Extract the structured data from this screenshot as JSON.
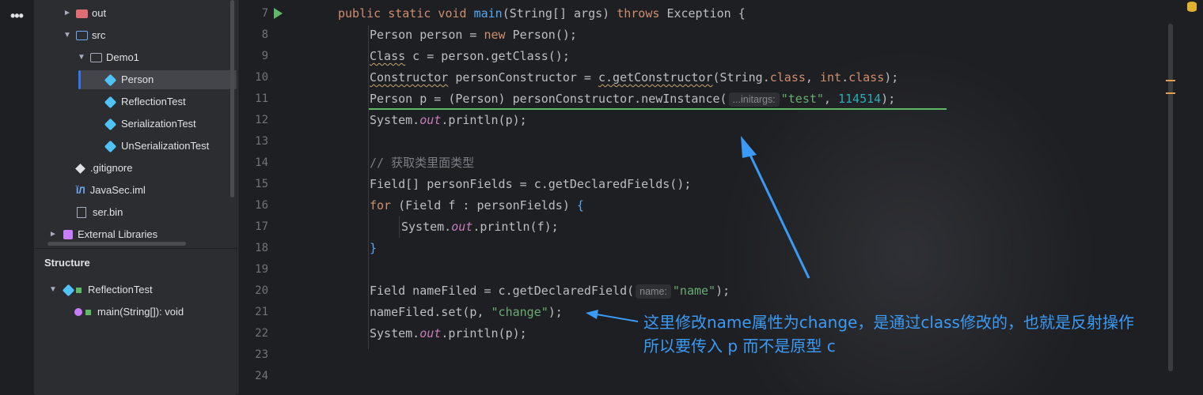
{
  "project_tree": {
    "items": [
      {
        "label": "out",
        "icon": "folder-excluded-icon"
      },
      {
        "label": "src",
        "icon": "source-folder-icon"
      },
      {
        "label": "Demo1",
        "icon": "package-icon"
      },
      {
        "label": "Person",
        "icon": "java-class-icon"
      },
      {
        "label": "ReflectionTest",
        "icon": "java-class-icon"
      },
      {
        "label": "SerializationTest",
        "icon": "java-class-icon"
      },
      {
        "label": "UnSerializationTest",
        "icon": "java-class-icon"
      },
      {
        "label": ".gitignore",
        "icon": "git-icon"
      },
      {
        "label": "JavaSec.iml",
        "icon": "iml-file-icon"
      },
      {
        "label": "ser.bin",
        "icon": "binary-file-icon"
      },
      {
        "label": "External Libraries",
        "icon": "libraries-icon"
      }
    ]
  },
  "structure": {
    "title": "Structure",
    "class_name": "ReflectionTest",
    "method": "main(String[]): void"
  },
  "editor": {
    "line_numbers": [
      "7",
      "8",
      "9",
      "10",
      "11",
      "12",
      "13",
      "14",
      "15",
      "16",
      "17",
      "18",
      "19",
      "20",
      "21",
      "22",
      "23",
      "24"
    ],
    "hints": {
      "initargs": "...initargs:",
      "name": "name:"
    },
    "strings": {
      "test": "\"test\"",
      "name": "\"name\"",
      "change": "\"change\""
    },
    "numbers": {
      "n114514": "114514"
    },
    "comment": "// 获取类里面类型"
  },
  "annotation": {
    "line1": "这里修改name属性为change，是通过class修改的，也就是反射操作",
    "line2": "所以要传入 p 而不是原型 c",
    "color": "#3b9af5"
  },
  "colors": {
    "keyword": "#cf8e6d",
    "function": "#56a8f5",
    "string": "#6aab73",
    "number": "#2aacb8",
    "selection": "#3574f0"
  }
}
